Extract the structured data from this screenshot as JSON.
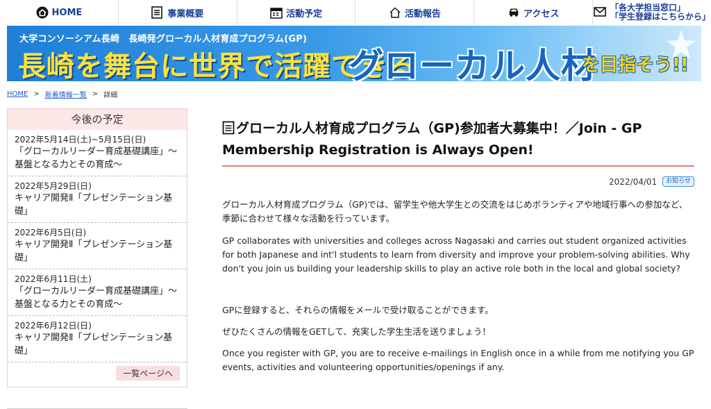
{
  "nav": {
    "home": "HOME",
    "business": "事業概要",
    "events": "活動予定",
    "reports": "活動報告",
    "access": "アクセス",
    "register_line1": "「各大学担当窓口」",
    "register_line2": "「学生登録はこちらから」"
  },
  "banner": {
    "subtitle": "大学コンソーシアム長崎　長崎発グローカル人材育成プログラム(GP)",
    "headline_part1": "長崎を舞台に世界で活躍できる",
    "headline_part2": "グローカル人材",
    "headline_part3": "を目指そう!!"
  },
  "breadcrumb": {
    "home": "HOME",
    "sep1": ">",
    "news": "新着情報一覧",
    "sep2": ">",
    "current": "詳細"
  },
  "sidebar": {
    "title": "今後の予定",
    "events": [
      {
        "date": "2022年5月14日(土)~5月15日(日)",
        "title": "「グローカルリーダー育成基礎講座」～基盤となる力とその育成～"
      },
      {
        "date": "2022年5月29日(日)",
        "title": "キャリア開発Ⅱ「プレゼンテーション基礎」"
      },
      {
        "date": "2022年6月5日(日)",
        "title": "キャリア開発Ⅱ「プレゼンテーション基礎」"
      },
      {
        "date": "2022年6月11日(土)",
        "title": "「グローカルリーダー育成基礎講座」～基盤となる力とその育成～"
      },
      {
        "date": "2022年6月12日(日)",
        "title": "キャリア開発Ⅱ「プレゼンテーション基礎」"
      }
    ],
    "more_label": "一覧ページへ"
  },
  "article": {
    "title": "グローカル人材育成プログラム（GP)参加者大募集中！／Join - GP Membership Registration is Always Open!",
    "date": "2022/04/01",
    "badge": "お知らせ",
    "paragraphs": [
      "グローカル人材育成プログラム（GP)では、留学生や他大学生との交流をはじめボランティアや地域行事への参加など、季節に合わせて様々な活動を行っています。",
      "GP collaborates with universities and colleges across Nagasaki and carries out student organized activities for both Japanese and int'l students to learn from diversity and improve your problem-solving abilities. Why don't you join us building your leadership skills to play an active role both in the local and global society?",
      "GPに登録すると、それらの情報をメールで受け取ることができます。",
      "ぜひたくさんの情報をGETして、充実した学生生活を送りましょう！",
      "Once you register with GP, you are to receive e-mailings in English once in a while from me notifying you GP events, activities and volunteering opportunities/openings if any."
    ]
  },
  "colors": {
    "nav_text": "#1a3f99",
    "banner_blue": "#1f7fd8",
    "banner_yellow": "#ffe23a",
    "sidebar_header": "#fde8e8",
    "title_underline": "#e87c7c"
  }
}
